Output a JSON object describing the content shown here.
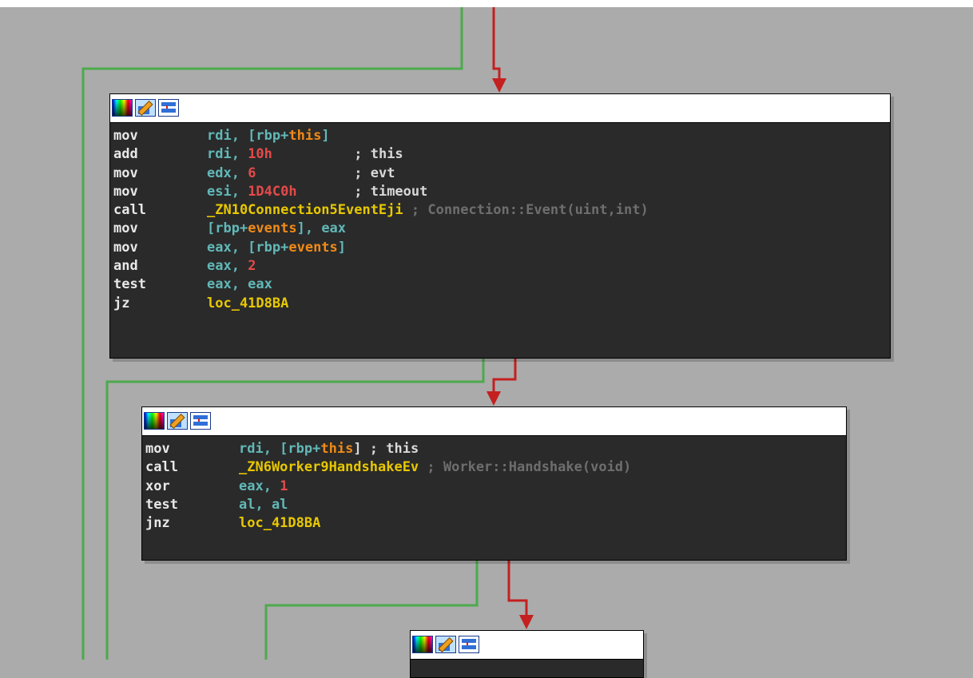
{
  "nodes": [
    {
      "lines": [
        {
          "mnemonic": "mov",
          "tokens": [
            {
              "t": "rdi, [rbp+",
              "c": "reg"
            },
            {
              "t": "this",
              "c": "var"
            },
            {
              "t": "]",
              "c": "reg"
            }
          ]
        },
        {
          "mnemonic": "add",
          "tokens": [
            {
              "t": "rdi, ",
              "c": "reg"
            },
            {
              "t": "10h",
              "c": "num"
            },
            {
              "t": "          ; this",
              "c": "cmt"
            }
          ]
        },
        {
          "mnemonic": "mov",
          "tokens": [
            {
              "t": "edx, ",
              "c": "reg"
            },
            {
              "t": "6",
              "c": "num"
            },
            {
              "t": "            ; evt",
              "c": "cmt"
            }
          ]
        },
        {
          "mnemonic": "mov",
          "tokens": [
            {
              "t": "esi, ",
              "c": "reg"
            },
            {
              "t": "1D4C0h",
              "c": "num"
            },
            {
              "t": "       ; timeout",
              "c": "cmt"
            }
          ]
        },
        {
          "mnemonic": "call",
          "tokens": [
            {
              "t": "_ZN10Connection5EventEji",
              "c": "lbl"
            },
            {
              "t": " ; Connection::Event(uint,int)",
              "c": "cmt2"
            }
          ]
        },
        {
          "mnemonic": "mov",
          "tokens": [
            {
              "t": "[rbp+",
              "c": "reg"
            },
            {
              "t": "events",
              "c": "var"
            },
            {
              "t": "], eax",
              "c": "reg"
            }
          ]
        },
        {
          "mnemonic": "mov",
          "tokens": [
            {
              "t": "eax, [rbp+",
              "c": "reg"
            },
            {
              "t": "events",
              "c": "var"
            },
            {
              "t": "]",
              "c": "reg"
            }
          ]
        },
        {
          "mnemonic": "and",
          "tokens": [
            {
              "t": "eax, ",
              "c": "reg"
            },
            {
              "t": "2",
              "c": "num"
            }
          ]
        },
        {
          "mnemonic": "test",
          "tokens": [
            {
              "t": "eax, eax",
              "c": "reg"
            }
          ]
        },
        {
          "mnemonic": "jz",
          "tokens": [
            {
              "t": "loc_41D8BA",
              "c": "lbl"
            }
          ]
        }
      ]
    },
    {
      "lines": [
        {
          "mnemonic": "mov",
          "tokens": [
            {
              "t": "rdi, [rbp+",
              "c": "reg"
            },
            {
              "t": "this",
              "c": "var"
            },
            {
              "t": "] ; this",
              "c": "cmt"
            }
          ]
        },
        {
          "mnemonic": "call",
          "tokens": [
            {
              "t": "_ZN6Worker9HandshakeEv",
              "c": "lbl"
            },
            {
              "t": " ; Worker::Handshake(void)",
              "c": "cmt2"
            }
          ]
        },
        {
          "mnemonic": "xor",
          "tokens": [
            {
              "t": "eax, ",
              "c": "reg"
            },
            {
              "t": "1",
              "c": "num"
            }
          ]
        },
        {
          "mnemonic": "test",
          "tokens": [
            {
              "t": "al, al",
              "c": "reg"
            }
          ]
        },
        {
          "mnemonic": "jnz",
          "tokens": [
            {
              "t": "loc_41D8BA",
              "c": "lbl"
            }
          ]
        }
      ]
    },
    {
      "lines": []
    }
  ],
  "toolbar_icons": [
    "color-palette-icon",
    "edit-pencil-icon",
    "graph-view-icon"
  ],
  "colors": {
    "background": "#ababab",
    "true_edge": "#4caa4c",
    "false_edge": "#c42020",
    "node_body": "#2a2a2a",
    "register": "#62b8b8",
    "number": "#e34a4a",
    "variable": "#f08a18",
    "label": "#e8c800"
  }
}
